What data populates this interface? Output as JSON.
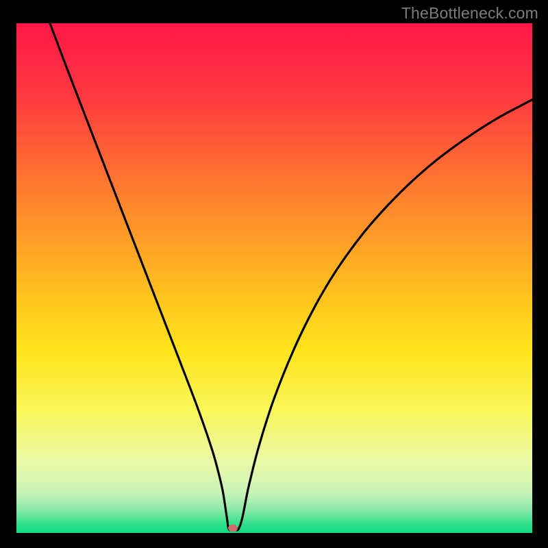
{
  "watermark": "TheBottleneck.com",
  "chart_data": {
    "type": "line",
    "title": "",
    "xlabel": "",
    "ylabel": "",
    "xlim": [
      0,
      100
    ],
    "ylim": [
      0,
      100
    ],
    "grid": false,
    "legend": false,
    "curve": {
      "name": "bottleneck-curve",
      "x": [
        6.5,
        10,
        14,
        18,
        22,
        26,
        30,
        34,
        36,
        38,
        39,
        40,
        40.8,
        41.2,
        42.2,
        43.0,
        43.8,
        45,
        47,
        50,
        54,
        58,
        62,
        67,
        72,
        77,
        82,
        88,
        94,
        100
      ],
      "y": [
        100,
        90.6,
        80.1,
        69.6,
        59.1,
        48.6,
        38.1,
        27.6,
        22.1,
        16.1,
        12.5,
        8.2,
        3.0,
        0.7,
        0.7,
        0.7,
        3.0,
        9.0,
        17.0,
        26.5,
        36.5,
        44.7,
        51.5,
        58.5,
        64.3,
        69.3,
        73.6,
        78.0,
        81.8,
        85.0
      ]
    },
    "marker": {
      "x": 42.0,
      "y": 0.9,
      "color": "#d16a6a"
    },
    "gradient_stops": [
      {
        "offset": 0.0,
        "color": "#ff1747"
      },
      {
        "offset": 0.15,
        "color": "#ff3b3f"
      },
      {
        "offset": 0.32,
        "color": "#ff7a2f"
      },
      {
        "offset": 0.5,
        "color": "#ffb720"
      },
      {
        "offset": 0.64,
        "color": "#ffe31a"
      },
      {
        "offset": 0.76,
        "color": "#f9f75a"
      },
      {
        "offset": 0.86,
        "color": "#eaf8a6"
      },
      {
        "offset": 0.92,
        "color": "#c9f4b8"
      },
      {
        "offset": 0.955,
        "color": "#8ae9a9"
      },
      {
        "offset": 0.985,
        "color": "#28df88"
      },
      {
        "offset": 1.0,
        "color": "#10db82"
      }
    ]
  }
}
